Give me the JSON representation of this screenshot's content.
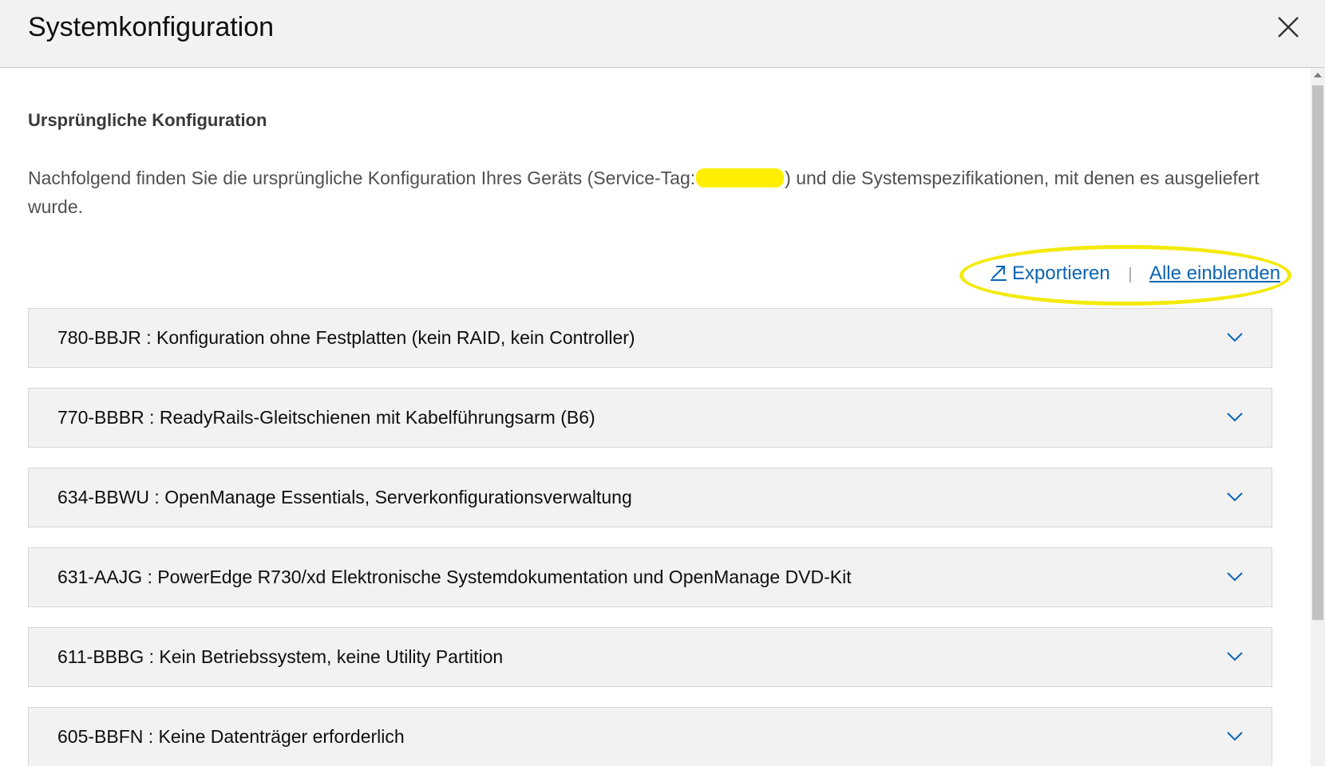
{
  "header": {
    "title": "Systemkonfiguration",
    "close_icon": "close-x-icon"
  },
  "section": {
    "heading": "Ursprüngliche Konfiguration",
    "description_before": "Nachfolgend finden Sie die ursprüngliche Konfiguration Ihres Geräts (Service-Tag:",
    "description_after": ") und die Systemspezifikationen, mit denen es ausgeliefert wurde."
  },
  "toolbar": {
    "export_label": "Exportieren",
    "export_icon": "external-link-icon",
    "separator": "|",
    "show_all_label": "Alle einblenden"
  },
  "colors": {
    "link": "#0a64b4",
    "highlight": "#f3ea0b",
    "redaction": "#ffee00",
    "panel_bg": "#f2f2f2"
  },
  "accordion": {
    "items": [
      {
        "label": "780-BBJR : Konfiguration ohne Festplatten (kein RAID, kein Controller)",
        "icon": "chevron-down-icon"
      },
      {
        "label": "770-BBBR : ReadyRails-Gleitschienen mit Kabelführungsarm (B6)",
        "icon": "chevron-down-icon"
      },
      {
        "label": "634-BBWU : OpenManage Essentials, Serverkonfigurationsverwaltung",
        "icon": "chevron-down-icon"
      },
      {
        "label": "631-AAJG : PowerEdge R730/xd Elektronische Systemdokumentation und OpenManage DVD-Kit",
        "icon": "chevron-down-icon"
      },
      {
        "label": "611-BBBG : Kein Betriebssystem, keine Utility Partition",
        "icon": "chevron-down-icon"
      },
      {
        "label": "605-BBFN : Keine Datenträger erforderlich",
        "icon": "chevron-down-icon"
      }
    ]
  }
}
